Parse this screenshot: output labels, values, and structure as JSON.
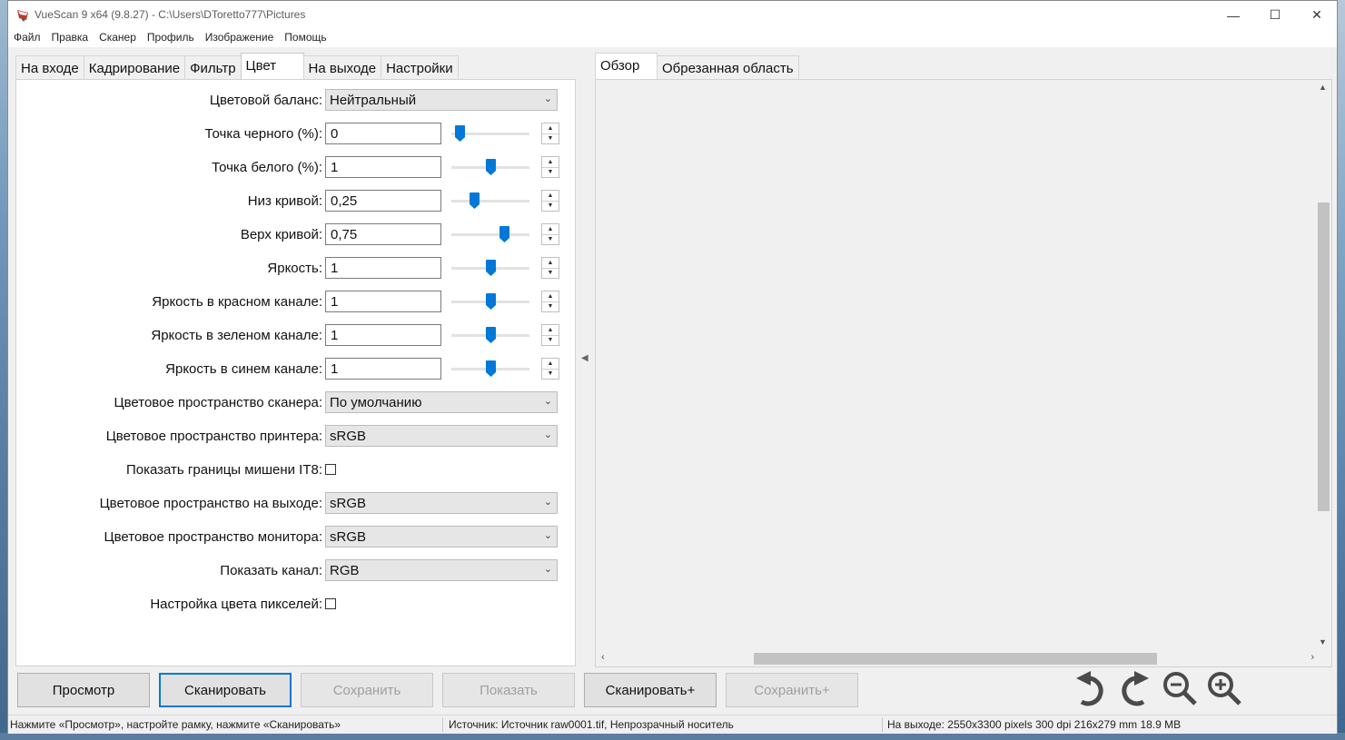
{
  "window": {
    "title": "VueScan 9 x64 (9.8.27) - C:\\Users\\DToretto777\\Pictures",
    "controls": {
      "minimize": "—",
      "maximize": "☐",
      "close": "✕"
    }
  },
  "menu": [
    "Файл",
    "Правка",
    "Сканер",
    "Профиль",
    "Изображение",
    "Помощь"
  ],
  "tabs": [
    "На входе",
    "Кадрирование",
    "Фильтр",
    "Цвет",
    "На выходе",
    "Настройки"
  ],
  "active_tab": "Цвет",
  "settings": {
    "color_balance": {
      "label": "Цветовой баланс:",
      "value": "Нейтральный"
    },
    "black_point": {
      "label": "Точка черного (%):",
      "value": "0",
      "slider": 0.05
    },
    "white_point": {
      "label": "Точка белого (%):",
      "value": "1",
      "slider": 0.5
    },
    "curve_low": {
      "label": "Низ кривой:",
      "value": "0,25",
      "slider": 0.27
    },
    "curve_high": {
      "label": "Верх кривой:",
      "value": "0,75",
      "slider": 0.71
    },
    "brightness": {
      "label": "Яркость:",
      "value": "1",
      "slider": 0.5
    },
    "brightness_red": {
      "label": "Яркость в красном канале:",
      "value": "1",
      "slider": 0.5
    },
    "brightness_green": {
      "label": "Яркость в зеленом канале:",
      "value": "1",
      "slider": 0.5
    },
    "brightness_blue": {
      "label": "Яркость в синем канале:",
      "value": "1",
      "slider": 0.5
    },
    "scanner_space": {
      "label": "Цветовое пространство сканера:",
      "value": "По умолчанию"
    },
    "printer_space": {
      "label": "Цветовое пространство принтера:",
      "value": "sRGB"
    },
    "it8_bounds": {
      "label": "Показать границы мишени IT8:",
      "checked": false
    },
    "output_space": {
      "label": "Цветовое пространство на выходе:",
      "value": "sRGB"
    },
    "monitor_space": {
      "label": "Цветовое пространство монитора:",
      "value": "sRGB"
    },
    "show_channel": {
      "label": "Показать канал:",
      "value": "RGB"
    },
    "pixel_color": {
      "label": "Настройка цвета пикселей:",
      "checked": false
    }
  },
  "right_tabs": [
    "Обзор",
    "Обрезанная область"
  ],
  "right_active_tab": "Обзор",
  "buttons": {
    "preview": "Просмотр",
    "scan": "Сканировать",
    "save": "Сохранить",
    "show": "Показать",
    "scan_plus": "Сканировать+",
    "save_plus": "Сохранить+"
  },
  "disabled_buttons": [
    "save",
    "show",
    "save_plus"
  ],
  "tools": [
    "rotate-left-icon",
    "rotate-right-icon",
    "zoom-out-icon",
    "zoom-in-icon"
  ],
  "status": {
    "hint": "Нажмите «Просмотр», настройте рамку, нажмите «Сканировать»",
    "source": "Источник: Источник raw0001.tif, Непрозрачный носитель",
    "output": "На выходе: 2550x3300 pixels 300 dpi 216x279 mm 18.9 MB"
  },
  "colors": {
    "accent": "#0078d7",
    "window_bg": "#f0f0f0",
    "panel_bg": "#ffffff"
  }
}
